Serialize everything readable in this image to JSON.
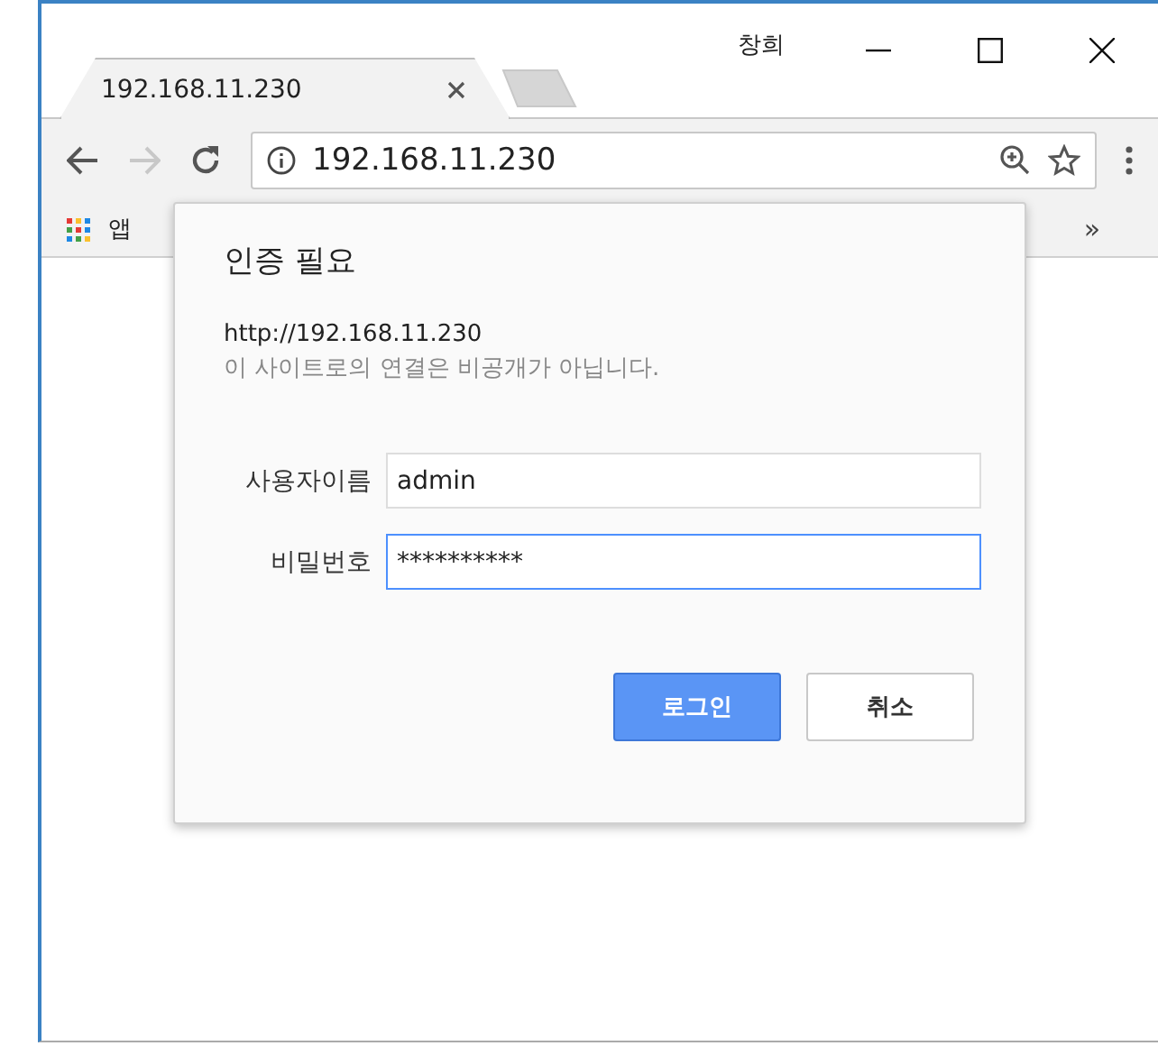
{
  "window": {
    "user": "창희"
  },
  "tabs": [
    {
      "title": "192.168.11.230",
      "selected": true
    }
  ],
  "address_bar": {
    "url": "192.168.11.230"
  },
  "bookmarks_bar": {
    "items": [
      {
        "label": "앱"
      }
    ],
    "overflow": "»"
  },
  "dialog": {
    "title": "인증 필요",
    "origin": "http://192.168.11.230",
    "warning": "이 사이트로의 연결은 비공개가 아닙니다.",
    "fields": [
      {
        "label": "사용자이름",
        "value": "admin",
        "focused": false
      },
      {
        "label": "비밀번호",
        "value": "**********",
        "focused": true
      }
    ],
    "buttons": [
      {
        "label": "로그인",
        "kind": "primary"
      },
      {
        "label": "취소",
        "kind": "secondary"
      }
    ]
  }
}
